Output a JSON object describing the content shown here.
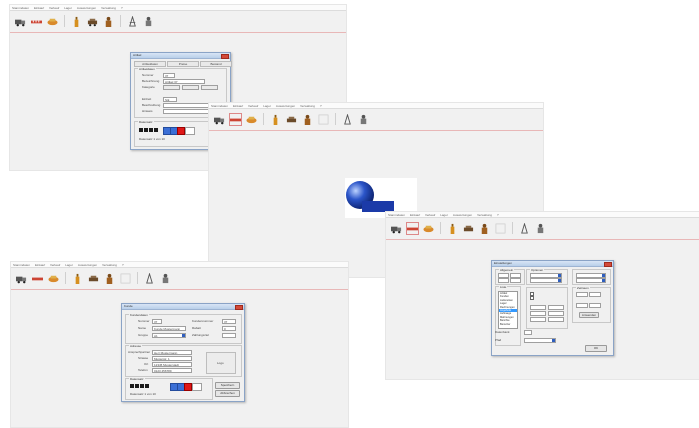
{
  "screens": {
    "top_left": {
      "menu": [
        "Stammdaten",
        "Einkauf",
        "Verkauf",
        "Lager",
        "Auswertungen",
        "Verwaltung",
        "?"
      ],
      "dialog": {
        "title": "Artikel",
        "tabs": [
          "Artikeldaten",
          "Preise",
          "Bestand"
        ],
        "group1": "Artikeldaten",
        "fields": [
          {
            "label": "Nummer",
            "value": "37"
          },
          {
            "label": "Bezeichnung",
            "value": "Artikel 37"
          },
          {
            "label": "Kategorie",
            "value": ""
          },
          {
            "label": "Einheit",
            "value": "Stk"
          },
          {
            "label": "Beschreibung",
            "value": ""
          },
          {
            "label": "Hinweis",
            "value": ""
          }
        ],
        "nav_label": "Datensatz",
        "status": "Datensatz 1 von 10"
      }
    },
    "center": {
      "menu": [
        "Stammdaten",
        "Einkauf",
        "Verkauf",
        "Lager",
        "Auswertungen",
        "Verwaltung",
        "?"
      ]
    },
    "logo": {
      "line1": "Ingenieurs- &",
      "line2": "Softwaretechnik"
    },
    "bottom_left": {
      "menu": [
        "Stammdaten",
        "Einkauf",
        "Verkauf",
        "Lager",
        "Auswertungen",
        "Verwaltung",
        "?"
      ],
      "dialog": {
        "title": "Kunde",
        "group1": "Kundendaten",
        "fields_left": [
          {
            "label": "Nummer",
            "value": "37"
          },
          {
            "label": "Name",
            "value": "Kunde Mustermann"
          },
          {
            "label": "Gruppe",
            "value": "A1"
          }
        ],
        "fields_right": [
          {
            "label": "Kundennummer",
            "value": "37"
          },
          {
            "label": "Rabatt",
            "value": "0"
          },
          {
            "label": "Zahlungsziel",
            "value": ""
          }
        ],
        "group2": "Adresse",
        "address": [
          {
            "label": "Ansprechpartner",
            "value": "Herr Mustermann"
          },
          {
            "label": "Strasse",
            "value": "Musterstr. 1"
          },
          {
            "label": "Ort",
            "value": "12345 Musterstadt"
          },
          {
            "label": "Telefon",
            "value": "0123 456789"
          }
        ],
        "image_label": "Logo",
        "nav_label": "Datensatz",
        "status": "Datensatz 1 von 10",
        "btn_ok": "Speichern",
        "btn_cancel": "Abbrechen"
      }
    },
    "bottom_right": {
      "menu": [
        "Stammdaten",
        "Einkauf",
        "Verkauf",
        "Lager",
        "Auswertungen",
        "Verwaltung",
        "?"
      ],
      "dialog": {
        "title": "Einstellungen",
        "group_a": "Allgemein",
        "group_b": "Liste",
        "group_c": "Optionen",
        "group_d": "Zeitraum",
        "list_items": [
          "Artikel",
          "Kunden",
          "Lieferanten",
          "Lager",
          "Rechnungen",
          "Angebote",
          "Auftraege",
          "Mahnungen",
          "Berichte",
          "Benutzer"
        ],
        "selected_index": 5,
        "field_a": "Datenbank",
        "field_b": "Pfad",
        "btn": "OK",
        "btn2": "Anwenden"
      }
    }
  },
  "colors": {
    "screen_bg": "#f1f1f1",
    "dialog_border": "#8aa3c6",
    "close_button": "#d34a3a",
    "separator": "#e8b7b7"
  },
  "toolbar_icons": [
    "truck-icon",
    "ruler-icon",
    "hand-money-icon",
    "bottle-icon",
    "car-icon",
    "person-icon",
    "blank-icon",
    "tower-icon",
    "worker-icon"
  ]
}
